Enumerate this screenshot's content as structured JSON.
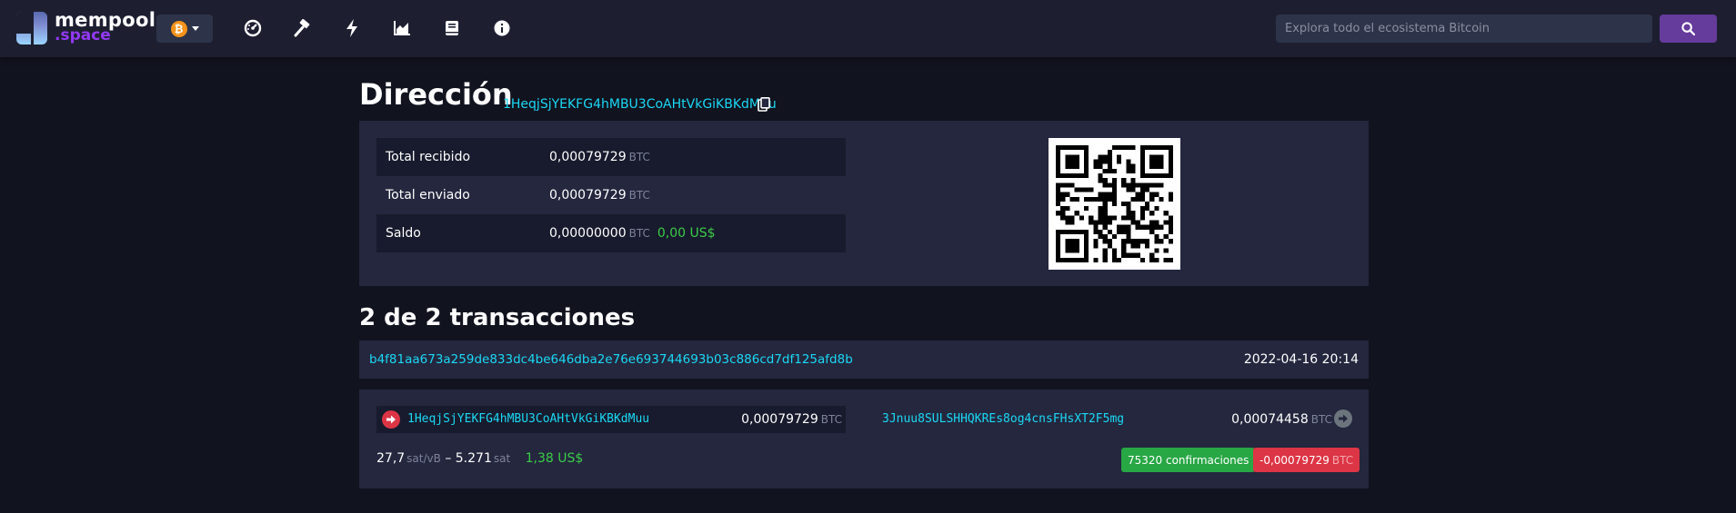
{
  "brand": {
    "line1": "mempool",
    "line2": ".space"
  },
  "network": {
    "symbol": "₿"
  },
  "nav": [
    {
      "name": "dashboard-icon"
    },
    {
      "name": "mining-icon"
    },
    {
      "name": "lightning-icon"
    },
    {
      "name": "graphs-icon"
    },
    {
      "name": "docs-icon"
    },
    {
      "name": "about-icon"
    }
  ],
  "search": {
    "placeholder": "Explora todo el ecosistema Bitcoin"
  },
  "page": {
    "title": "Dirección",
    "address": "1HeqjSjYEKFG4hMBU3CoAHtVkGiKBKdMuu"
  },
  "summary": {
    "rows": [
      {
        "label": "Total recibido",
        "value": "0,00079729",
        "unit": "BTC",
        "fiat": ""
      },
      {
        "label": "Total enviado",
        "value": "0,00079729",
        "unit": "BTC",
        "fiat": ""
      },
      {
        "label": "Saldo",
        "value": "0,00000000",
        "unit": "BTC",
        "fiat": "0,00 US$"
      }
    ]
  },
  "transactions": {
    "heading": "2 de 2 transacciones",
    "items": [
      {
        "txid": "b4f81aa673a259de833dc4be646dba2e76e693744693b03c886cd7df125afd8b",
        "time": "2022-04-16 20:14",
        "input": {
          "address": "1HeqjSjYEKFG4hMBU3CoAHtVkGiKBKdMuu",
          "amount": "0,00079729",
          "unit": "BTC"
        },
        "output": {
          "address": "3Jnuu8SULSHHQKREs8og4cnsFHsXT2F5mg",
          "amount": "0,00074458",
          "unit": "BTC"
        },
        "fee_rate": "27,7",
        "fee_rate_unit": "sat/vB",
        "fee_sep": "–",
        "fee": "5.271",
        "fee_unit": "sat",
        "fee_fiat": "1,38 US$",
        "confirmations": "75320 confirmaciones",
        "delta": "-0,00079729",
        "delta_unit": "BTC"
      }
    ]
  },
  "colors": {
    "accent": "#1bd8f4",
    "brand": "#9339f4",
    "success": "#28a745",
    "danger": "#dc3545",
    "fiat": "#3bcc49"
  }
}
